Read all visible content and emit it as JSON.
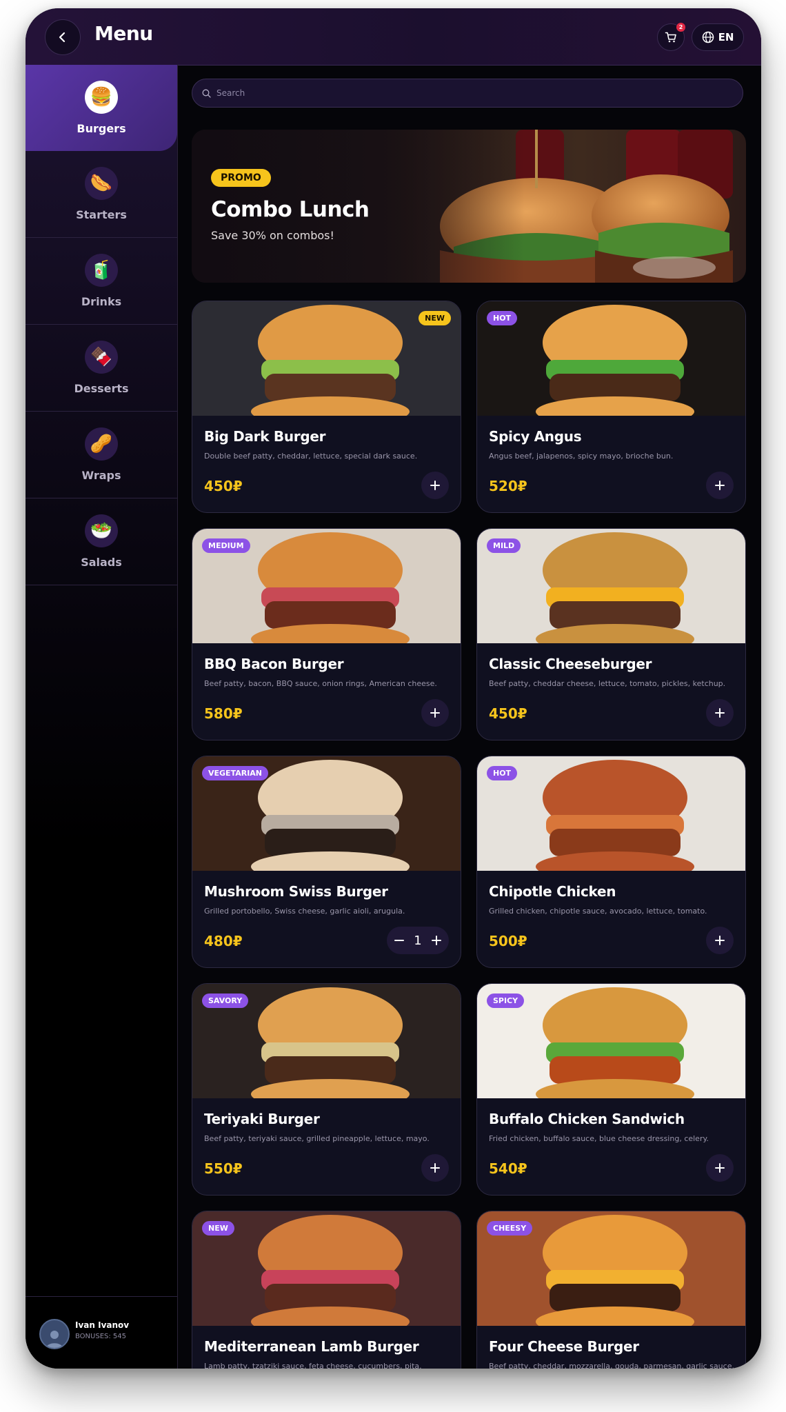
{
  "header": {
    "title": "Menu",
    "cart_count": "2",
    "lang": "EN"
  },
  "sidebar": {
    "categories": [
      {
        "label": "Burgers",
        "icon": "burger-icon",
        "glyph": "🍔",
        "active": true
      },
      {
        "label": "Starters",
        "icon": "sausage-icon",
        "glyph": "🌭",
        "active": false
      },
      {
        "label": "Drinks",
        "icon": "juice-box-icon",
        "glyph": "🧃",
        "active": false
      },
      {
        "label": "Desserts",
        "icon": "chocolate-icon",
        "glyph": "🍫",
        "active": false
      },
      {
        "label": "Wraps",
        "icon": "peanut-icon",
        "glyph": "🥜",
        "active": false
      },
      {
        "label": "Salads",
        "icon": "salad-icon",
        "glyph": "🥗",
        "active": false
      }
    ],
    "user": {
      "name": "Ivan Ivanov",
      "bonus": "BONUSES: 545"
    }
  },
  "search": {
    "placeholder": "Search"
  },
  "promo": {
    "badge": "PROMO",
    "title": "Combo Lunch",
    "subtitle": "Save 30% on combos!"
  },
  "items": [
    {
      "title": "Big Dark Burger",
      "desc": "Double beef patty, cheddar, lettuce, special dark sauce.",
      "price": "450₽",
      "tag": "NEW",
      "tag_style": "yellow",
      "tag_side": "right",
      "quantity": 0
    },
    {
      "title": "Spicy Angus",
      "desc": "Angus beef, jalapenos, spicy mayo, brioche bun.",
      "price": "520₽",
      "tag": "HOT",
      "tag_style": "purple",
      "tag_side": "left",
      "quantity": 0
    },
    {
      "title": "BBQ Bacon Burger",
      "desc": "Beef patty, bacon, BBQ sauce, onion rings, American cheese.",
      "price": "580₽",
      "tag": "MEDIUM",
      "tag_style": "purple",
      "tag_side": "left",
      "quantity": 0
    },
    {
      "title": "Classic Cheeseburger",
      "desc": "Beef patty, cheddar cheese, lettuce, tomato, pickles, ketchup.",
      "price": "450₽",
      "tag": "MILD",
      "tag_style": "purple",
      "tag_side": "left",
      "quantity": 0
    },
    {
      "title": "Mushroom Swiss Burger",
      "desc": "Grilled portobello, Swiss cheese, garlic aioli, arugula.",
      "price": "480₽",
      "tag": "VEGETARIAN",
      "tag_style": "purple",
      "tag_side": "left",
      "quantity": 1
    },
    {
      "title": "Chipotle Chicken",
      "desc": "Grilled chicken, chipotle sauce, avocado, lettuce, tomato.",
      "price": "500₽",
      "tag": "HOT",
      "tag_style": "purple",
      "tag_side": "left",
      "quantity": 0
    },
    {
      "title": "Teriyaki Burger",
      "desc": "Beef patty, teriyaki sauce, grilled pineapple, lettuce, mayo.",
      "price": "550₽",
      "tag": "SAVORY",
      "tag_style": "purple",
      "tag_side": "left",
      "quantity": 0
    },
    {
      "title": "Buffalo Chicken Sandwich",
      "desc": "Fried chicken, buffalo sauce, blue cheese dressing, celery.",
      "price": "540₽",
      "tag": "SPICY",
      "tag_style": "purple",
      "tag_side": "left",
      "quantity": 0
    },
    {
      "title": "Mediterranean Lamb Burger",
      "desc": "Lamb patty, tzatziki sauce, feta cheese, cucumbers, pita.",
      "price": "",
      "tag": "NEW",
      "tag_style": "purple",
      "tag_side": "left",
      "quantity": 0
    },
    {
      "title": "Four Cheese Burger",
      "desc": "Beef patty, cheddar, mozzarella, gouda, parmesan, garlic sauce.",
      "price": "",
      "tag": "CHEESY",
      "tag_style": "purple",
      "tag_side": "left",
      "quantity": 0
    }
  ],
  "colors": {
    "accent_purple": "#8c52e6",
    "price_yellow": "#f6c41c",
    "badge_yellow": "#f6c41c",
    "background": "#050509"
  }
}
